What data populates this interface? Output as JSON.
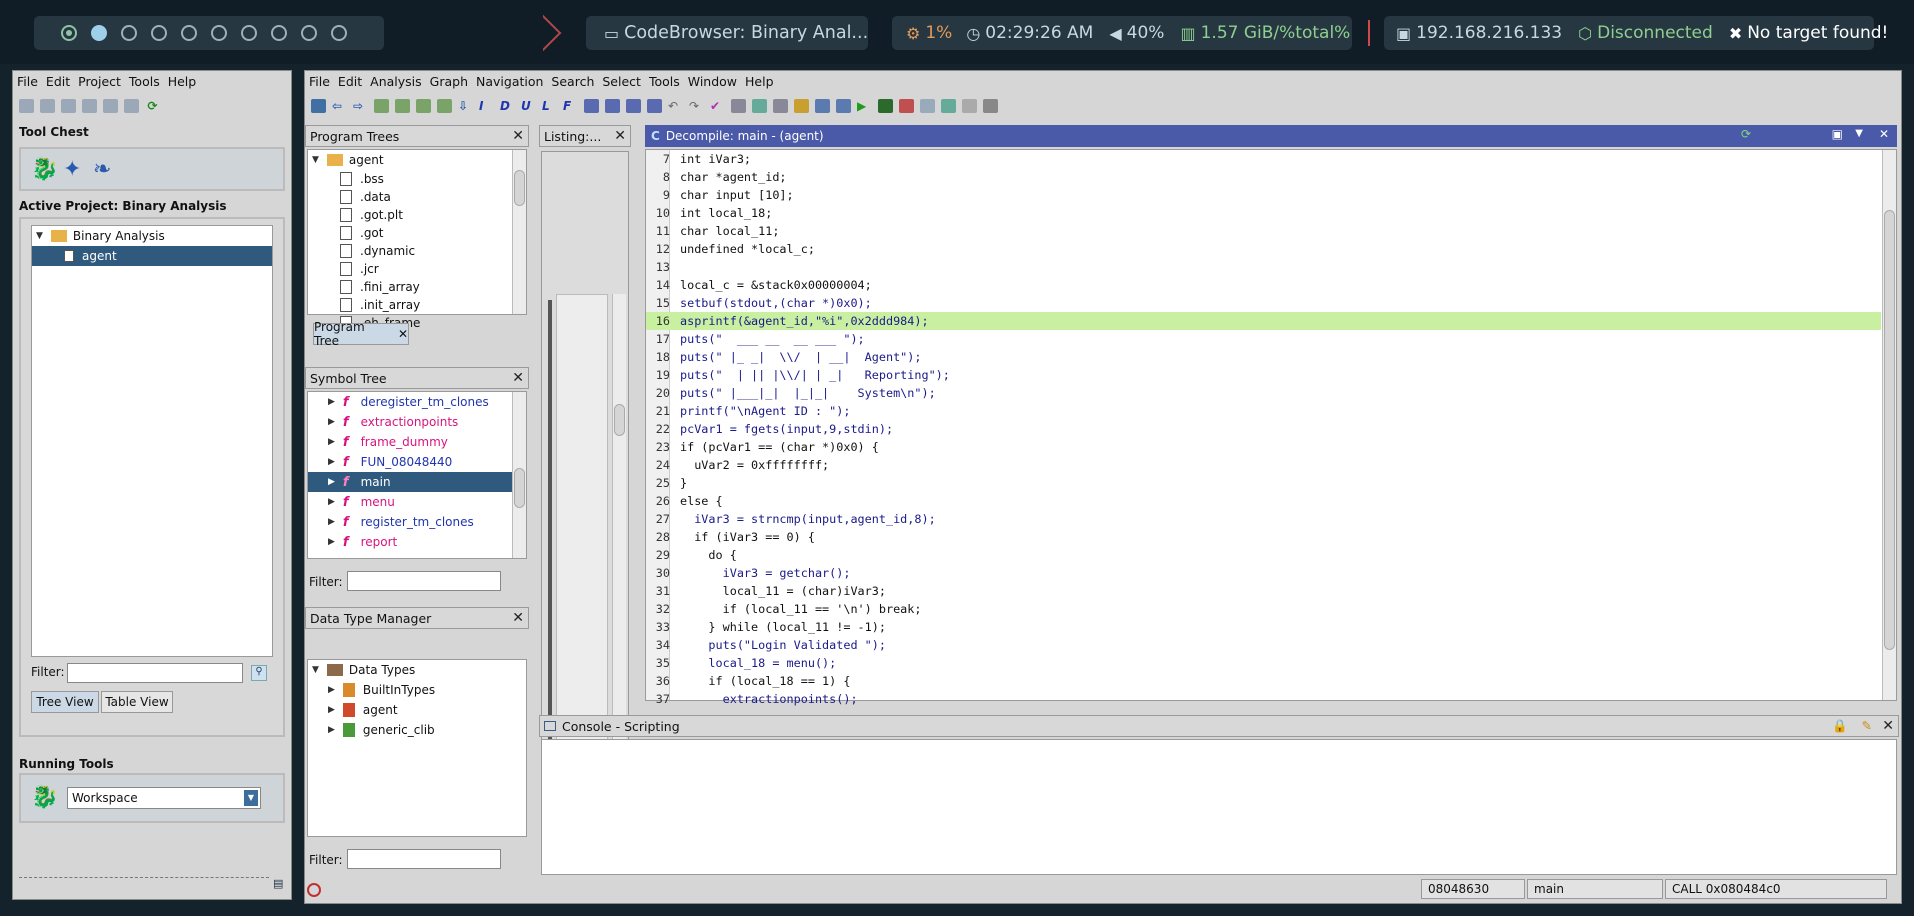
{
  "taskbar": {
    "window_title": "CodeBrowser: Binary Anal...",
    "cpu": "1%",
    "time": "02:29:26 AM",
    "volume": "40%",
    "memory": "1.57 GiB/%total%",
    "ip": "192.168.216.133",
    "vpn": "Disconnected",
    "target": "No target found!"
  },
  "project_window": {
    "menu": [
      "File",
      "Edit",
      "Project",
      "Tools",
      "Help"
    ],
    "tool_chest_label": "Tool Chest",
    "active_project_label": "Active Project: Binary Analysis",
    "tree_root": "Binary Analysis",
    "tree_child": "agent",
    "filter_label": "Filter:",
    "tree_view_tab": "Tree View",
    "table_view_tab": "Table View",
    "running_tools_label": "Running Tools",
    "workspace_value": "Workspace"
  },
  "codebrowser": {
    "menu": [
      "File",
      "Edit",
      "Analysis",
      "Graph",
      "Navigation",
      "Search",
      "Select",
      "Tools",
      "Window",
      "Help"
    ],
    "program_trees": {
      "title": "Program Trees",
      "root": "agent",
      "items": [
        ".bss",
        ".data",
        ".got.plt",
        ".got",
        ".dynamic",
        ".jcr",
        ".fini_array",
        ".init_array",
        ".eh_frame"
      ],
      "tab": "Program Tree"
    },
    "listing_title": "Listing:...",
    "symbol_tree": {
      "title": "Symbol Tree",
      "items": [
        "deregister_tm_clones",
        "extractionpoints",
        "frame_dummy",
        "FUN_08048440",
        "main",
        "menu",
        "register_tm_clones",
        "report"
      ],
      "filter_label": "Filter:"
    },
    "data_type_manager": {
      "title": "Data Type Manager",
      "root": "Data Types",
      "items": [
        "BuiltInTypes",
        "agent",
        "generic_clib"
      ],
      "filter_label": "Filter:"
    },
    "decompile_title": "Decompile: main - (agent)",
    "decompile_lines": [
      {
        "n": "7",
        "t": "int iVar3;"
      },
      {
        "n": "8",
        "t": "char *agent_id;"
      },
      {
        "n": "9",
        "t": "char input [10];"
      },
      {
        "n": "10",
        "t": "int local_18;"
      },
      {
        "n": "11",
        "t": "char local_11;"
      },
      {
        "n": "12",
        "t": "undefined *local_c;"
      },
      {
        "n": "13",
        "t": ""
      },
      {
        "n": "14",
        "t": "local_c = &stack0x00000004;"
      },
      {
        "n": "15",
        "t": "setbuf(stdout,(char *)0x0);"
      },
      {
        "n": "16",
        "t": "asprintf(&agent_id,\"%i\",0x2ddd984);"
      },
      {
        "n": "17",
        "t": "puts(\"  ___ __  __ ___ \");"
      },
      {
        "n": "18",
        "t": "puts(\" |_ _|  \\\\/  | __|  Agent\");"
      },
      {
        "n": "19",
        "t": "puts(\"  | || |\\\\/| | _|   Reporting\");"
      },
      {
        "n": "20",
        "t": "puts(\" |___|_|  |_|_|    System\\n\");"
      },
      {
        "n": "21",
        "t": "printf(\"\\nAgent ID : \");"
      },
      {
        "n": "22",
        "t": "pcVar1 = fgets(input,9,stdin);"
      },
      {
        "n": "23",
        "t": "if (pcVar1 == (char *)0x0) {"
      },
      {
        "n": "24",
        "t": "  uVar2 = 0xffffffff;"
      },
      {
        "n": "25",
        "t": "}"
      },
      {
        "n": "26",
        "t": "else {"
      },
      {
        "n": "27",
        "t": "  iVar3 = strncmp(input,agent_id,8);"
      },
      {
        "n": "28",
        "t": "  if (iVar3 == 0) {"
      },
      {
        "n": "29",
        "t": "    do {"
      },
      {
        "n": "30",
        "t": "      iVar3 = getchar();"
      },
      {
        "n": "31",
        "t": "      local_11 = (char)iVar3;"
      },
      {
        "n": "32",
        "t": "      if (local_11 == '\\n') break;"
      },
      {
        "n": "33",
        "t": "    } while (local_11 != -1);"
      },
      {
        "n": "34",
        "t": "    puts(\"Login Validated \");"
      },
      {
        "n": "35",
        "t": "    local_18 = menu();"
      },
      {
        "n": "36",
        "t": "    if (local_18 == 1) {"
      },
      {
        "n": "37",
        "t": "      extractionpoints();"
      }
    ],
    "console_title": "Console - Scripting",
    "status": {
      "address": "08048630",
      "function": "main",
      "instruction": "CALL 0x080484c0"
    }
  }
}
